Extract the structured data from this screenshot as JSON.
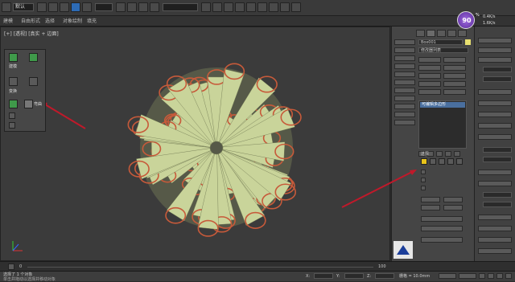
{
  "menubar": {
    "dropdown_value": "默认"
  },
  "viewport": {
    "label": "[+] [透视] [真实 + 边面]"
  },
  "ribbon": {
    "tabs": [
      "建模",
      "自由形式",
      "选择",
      "对象绘制",
      "填充"
    ]
  },
  "floating_panel": {
    "labels": [
      "建模",
      "变换",
      "弯曲"
    ]
  },
  "side_panel": {
    "object_name": "Box001",
    "modifier_label": "修改器列表",
    "stack_item": "可编辑多边形",
    "section_title": "选择",
    "color_accent": "#e8c41a"
  },
  "badge": {
    "value": "90",
    "unit": "%",
    "rate1": "0.4K/s",
    "rate2": "1.6K/s"
  },
  "timeline": {
    "frame_start": "0",
    "frame_end": "100"
  },
  "status": {
    "left_text": "选择了 1 个对象",
    "hint_text": "单击并拖动以选择并移动对象",
    "coord_x": "X:",
    "coord_y": "Y:",
    "coord_z": "Z:",
    "grid": "栅格 = 10.0mm"
  },
  "colors": {
    "arrow": "#c0192a",
    "mesh": "#c9d49a",
    "ring": "#c75a3a"
  }
}
